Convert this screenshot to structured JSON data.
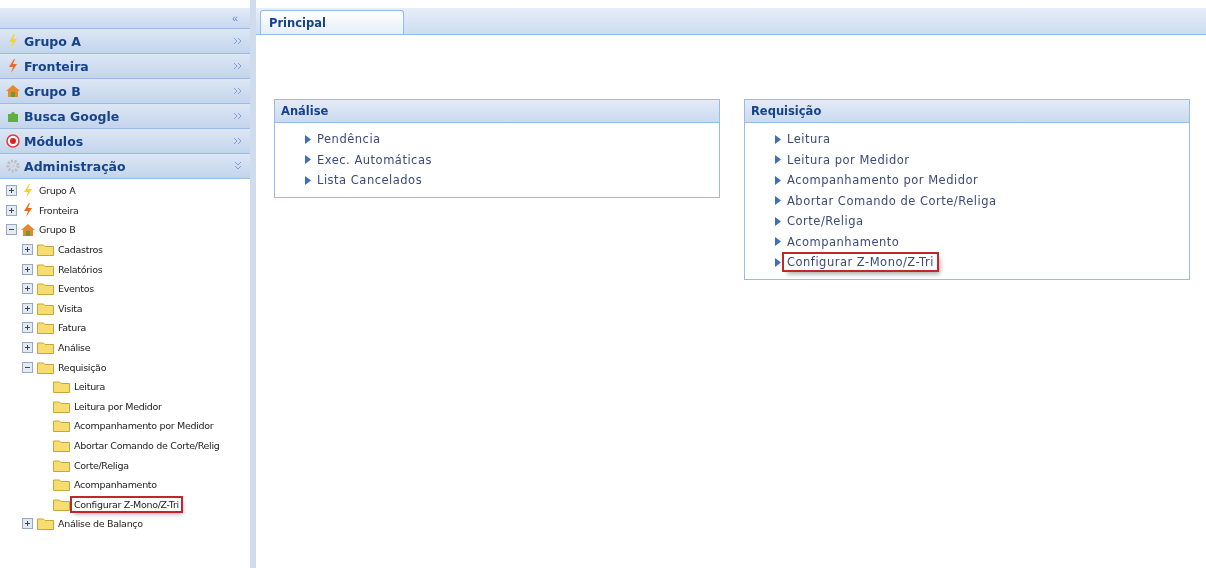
{
  "sidebar": {
    "collapse_icon": "«",
    "sections": [
      {
        "label": "Grupo A",
        "kind": "bolt",
        "expanded": false
      },
      {
        "label": "Fronteira",
        "kind": "flash",
        "expanded": false
      },
      {
        "label": "Grupo B",
        "kind": "home",
        "expanded": false
      },
      {
        "label": "Busca Google",
        "kind": "plugin",
        "expanded": false
      },
      {
        "label": "Módulos",
        "kind": "module",
        "expanded": false
      },
      {
        "label": "Administração",
        "kind": "admin",
        "expanded": true
      }
    ],
    "tree": [
      {
        "label": "Grupo A",
        "kind": "bolt",
        "expanded": false,
        "selected": false
      },
      {
        "label": "Fronteira",
        "kind": "flash",
        "expanded": false,
        "selected": false
      },
      {
        "label": "Grupo B",
        "kind": "home",
        "expanded": true,
        "selected": false,
        "children": [
          {
            "label": "Cadastros",
            "expanded": false,
            "selected": false
          },
          {
            "label": "Relatórios",
            "expanded": false,
            "selected": false
          },
          {
            "label": "Eventos",
            "expanded": false,
            "selected": false
          },
          {
            "label": "Visita",
            "expanded": false,
            "selected": false
          },
          {
            "label": "Fatura",
            "expanded": false,
            "selected": false
          },
          {
            "label": "Análise",
            "expanded": false,
            "selected": false
          },
          {
            "label": "Requisição",
            "expanded": true,
            "selected": false,
            "children": [
              {
                "label": "Leitura",
                "selected": false
              },
              {
                "label": "Leitura por Medidor",
                "selected": false
              },
              {
                "label": "Acompanhamento por Medidor",
                "selected": false
              },
              {
                "label": "Abortar Comando de Corte/Relig",
                "selected": false
              },
              {
                "label": "Corte/Religa",
                "selected": false
              },
              {
                "label": "Acompanhamento",
                "selected": false
              },
              {
                "label": "Configurar Z-Mono/Z-Tri",
                "selected": true
              }
            ]
          },
          {
            "label": "Análise de Balanço",
            "expanded": false,
            "selected": false
          }
        ]
      }
    ]
  },
  "tabs": [
    {
      "label": "Principal",
      "selected": true
    }
  ],
  "panels": [
    {
      "title": "Análise",
      "items": [
        {
          "label": "Pendência",
          "selected": false
        },
        {
          "label": "Exec. Automáticas",
          "selected": false
        },
        {
          "label": "Lista Cancelados",
          "selected": false
        }
      ]
    },
    {
      "title": "Requisição",
      "items": [
        {
          "label": "Leitura",
          "selected": false
        },
        {
          "label": "Leitura por Medidor",
          "selected": false
        },
        {
          "label": "Acompanhamento por Medidor",
          "selected": false
        },
        {
          "label": "Abortar Comando de Corte/Religa",
          "selected": false
        },
        {
          "label": "Corte/Religa",
          "selected": false
        },
        {
          "label": "Acompanhamento",
          "selected": false
        },
        {
          "label": "Configurar Z-Mono/Z-Tri",
          "selected": true
        }
      ]
    }
  ]
}
